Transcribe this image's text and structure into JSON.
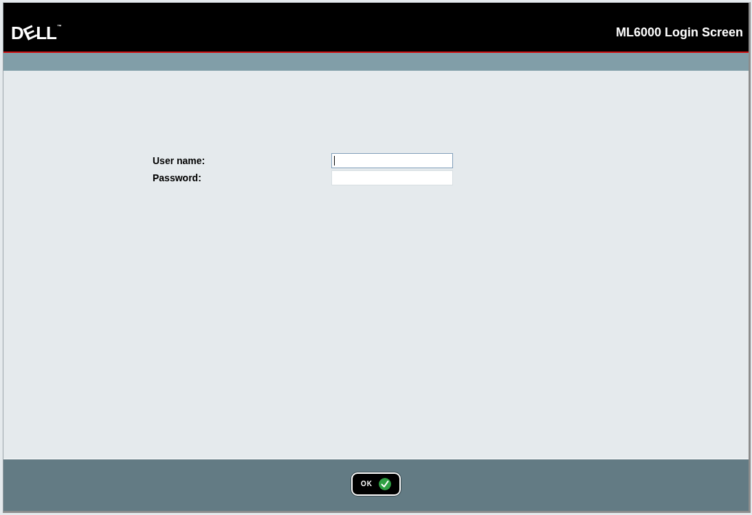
{
  "header": {
    "logo": {
      "text": "DELL",
      "trademark": "™"
    },
    "title": "ML6000 Login Screen"
  },
  "form": {
    "fields": [
      {
        "label": "User name:",
        "focused": true
      },
      {
        "label": "Password:",
        "focused": false
      }
    ]
  },
  "footer": {
    "buttons": [
      {
        "label": "OK"
      }
    ]
  }
}
